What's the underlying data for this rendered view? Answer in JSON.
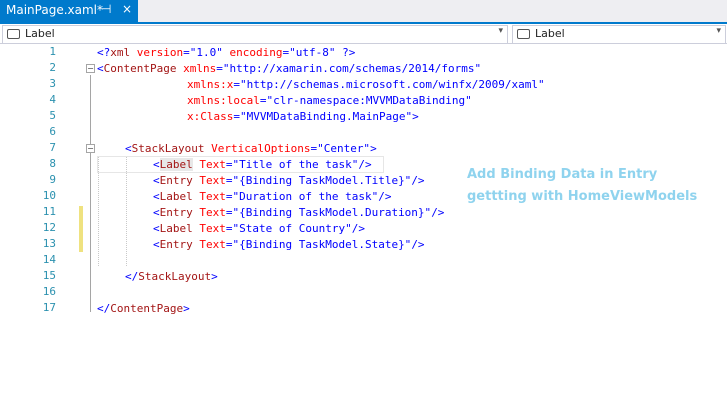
{
  "tab": {
    "title": "MainPage.xaml*",
    "pin_glyph": "⊣",
    "close_glyph": "×"
  },
  "nav": {
    "left_label": "Label",
    "right_label": "Label",
    "dropdown_glyph": "▾"
  },
  "line_numbers": [
    "1",
    "2",
    "3",
    "4",
    "5",
    "6",
    "7",
    "8",
    "9",
    "10",
    "11",
    "12",
    "13",
    "14",
    "15",
    "16",
    "17"
  ],
  "code": {
    "l1": [
      [
        "<?",
        "bl"
      ],
      [
        "xml",
        "br"
      ],
      [
        " ",
        "bk"
      ],
      [
        "version",
        "rd"
      ],
      [
        "=\"",
        "bl"
      ],
      [
        "1.0",
        "bl"
      ],
      [
        "\"",
        "bl"
      ],
      [
        " ",
        "bk"
      ],
      [
        "encoding",
        "rd"
      ],
      [
        "=\"",
        "bl"
      ],
      [
        "utf-8",
        "bl"
      ],
      [
        "\"",
        "bl"
      ],
      [
        " ?>",
        "bl"
      ]
    ],
    "l2": [
      [
        "<",
        "bl"
      ],
      [
        "ContentPage",
        "br"
      ],
      [
        " ",
        "bk"
      ],
      [
        "xmlns",
        "rd"
      ],
      [
        "=",
        "bl"
      ],
      [
        "\"http://xamarin.com/schemas/2014/forms\"",
        "bl"
      ]
    ],
    "l3": [
      [
        "xmlns:x",
        "rd"
      ],
      [
        "=",
        "bl"
      ],
      [
        "\"http://schemas.microsoft.com/winfx/2009/xaml\"",
        "bl"
      ]
    ],
    "l4": [
      [
        "xmlns:local",
        "rd"
      ],
      [
        "=",
        "bl"
      ],
      [
        "\"clr-namespace:MVVMDataBinding\"",
        "bl"
      ]
    ],
    "l5": [
      [
        "x:Class",
        "rd"
      ],
      [
        "=",
        "bl"
      ],
      [
        "\"MVVMDataBinding.MainPage\"",
        "bl"
      ],
      [
        ">",
        "bl"
      ]
    ],
    "l7": [
      [
        "<",
        "bl"
      ],
      [
        "StackLayout",
        "br"
      ],
      [
        " ",
        "bk"
      ],
      [
        "VerticalOptions",
        "rd"
      ],
      [
        "=",
        "bl"
      ],
      [
        "\"Center\"",
        "bl"
      ],
      [
        ">",
        "bl"
      ]
    ],
    "l8": [
      [
        "<",
        "bl"
      ],
      [
        "Label",
        "br",
        "hl"
      ],
      [
        " ",
        "bk"
      ],
      [
        "Text",
        "rd"
      ],
      [
        "=",
        "bl"
      ],
      [
        "\"Title of the task\"",
        "bl"
      ],
      [
        "/>",
        "bl"
      ]
    ],
    "l9": [
      [
        "<",
        "bl"
      ],
      [
        "Entry",
        "br"
      ],
      [
        " ",
        "bk"
      ],
      [
        "Text",
        "rd"
      ],
      [
        "=",
        "bl"
      ],
      [
        "\"{Binding TaskModel.Title}\"",
        "bl"
      ],
      [
        "/>",
        "bl"
      ]
    ],
    "l10": [
      [
        "<",
        "bl"
      ],
      [
        "Label",
        "br"
      ],
      [
        " ",
        "bk"
      ],
      [
        "Text",
        "rd"
      ],
      [
        "=",
        "bl"
      ],
      [
        "\"Duration of the task\"",
        "bl"
      ],
      [
        "/>",
        "bl"
      ]
    ],
    "l11": [
      [
        "<",
        "bl"
      ],
      [
        "Entry",
        "br"
      ],
      [
        " ",
        "bk"
      ],
      [
        "Text",
        "rd"
      ],
      [
        "=",
        "bl"
      ],
      [
        "\"{Binding TaskModel.Duration}\"",
        "bl"
      ],
      [
        "/>",
        "bl"
      ]
    ],
    "l12": [
      [
        "<",
        "bl"
      ],
      [
        "Label",
        "br"
      ],
      [
        " ",
        "bk"
      ],
      [
        "Text",
        "rd"
      ],
      [
        "=",
        "bl"
      ],
      [
        "\"State of Country\"",
        "bl"
      ],
      [
        "/>",
        "bl"
      ]
    ],
    "l13": [
      [
        "<",
        "bl"
      ],
      [
        "Entry",
        "br"
      ],
      [
        " ",
        "bk"
      ],
      [
        "Text",
        "rd"
      ],
      [
        "=",
        "bl"
      ],
      [
        "\"{Binding TaskModel.State}\"",
        "bl"
      ],
      [
        "/>",
        "bl"
      ]
    ],
    "l15": [
      [
        "</",
        "bl"
      ],
      [
        "StackLayout",
        "br"
      ],
      [
        ">",
        "bl"
      ]
    ],
    "l17": [
      [
        "</",
        "bl"
      ],
      [
        "ContentPage",
        "br"
      ],
      [
        ">",
        "bl"
      ]
    ]
  },
  "annotation": {
    "line1": "Add Binding Data in Entry",
    "line2": "gettting with HomeViewModels"
  },
  "colors": {
    "accent": "#007acc",
    "annotation": "#8fd3ee",
    "line_numbers": "#2b91af",
    "change_bar": "#efe280"
  }
}
